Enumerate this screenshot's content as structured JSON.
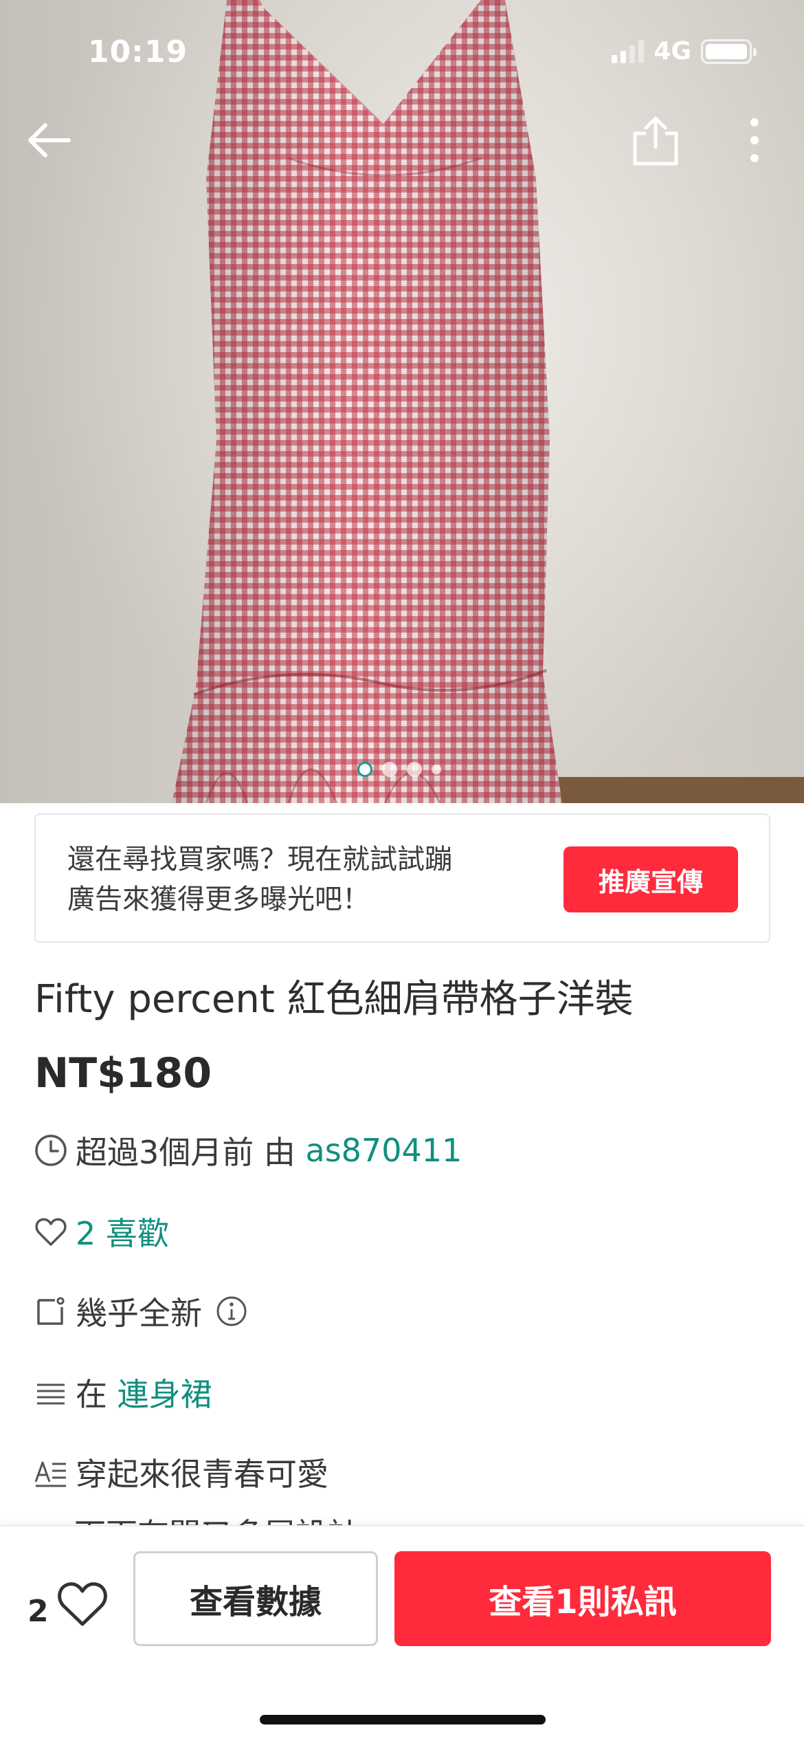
{
  "status_bar": {
    "time": "10:19",
    "network": "4G"
  },
  "hero": {
    "image_alt": "紅色格子細肩帶洋裝",
    "photo_count": 4,
    "active_photo_index": 0
  },
  "nav": {
    "back_icon": "back-arrow-icon",
    "share_icon": "share-icon",
    "more_icon": "more-vertical-icon"
  },
  "promo": {
    "line1": "還在尋找買家嗎？現在就試試蹦",
    "line2": "廣告來獲得更多曝光吧！",
    "button_label": "推廣宣傳"
  },
  "listing": {
    "title": "Fifty percent 紅色細肩帶格子洋裝",
    "price": "NT$180",
    "time_text": "超過3個月前 由 ",
    "seller": "as870411",
    "likes_text": "2 喜歡",
    "condition": "幾乎全新",
    "category_prefix": "在 ",
    "category": "連身裙",
    "description_line1": "穿起來很青春可愛",
    "description_line2": "下面有開叉多層設計"
  },
  "bottom_bar": {
    "like_count": "2",
    "stats_button": "查看數據",
    "chat_button": "查看1則私訊"
  },
  "colors": {
    "accent_red": "#ff2a3c",
    "link_teal": "#0f8f7e",
    "gingham_red": "#b22030"
  }
}
